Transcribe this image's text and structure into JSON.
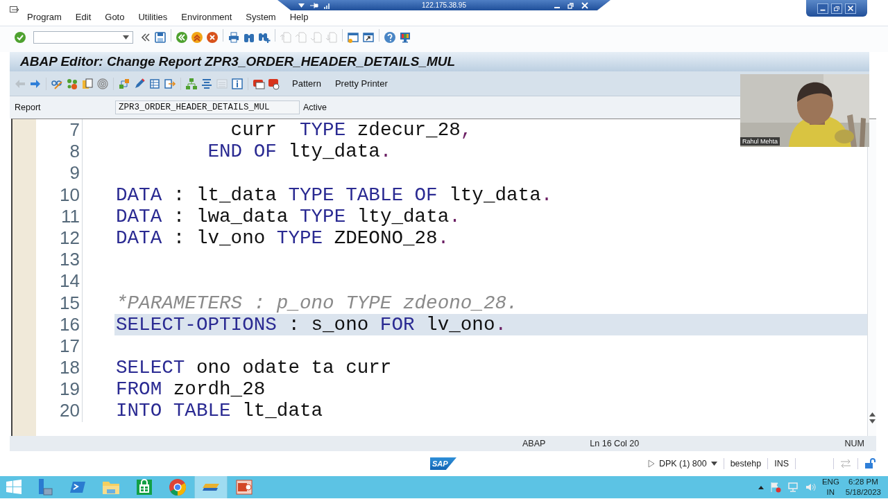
{
  "remote_bar": {
    "address": "122.175.38.95"
  },
  "menu": [
    "Program",
    "Edit",
    "Goto",
    "Utilities",
    "Environment",
    "System",
    "Help"
  ],
  "toolbar": {
    "groups": [
      [
        {
          "kind": "check",
          "disabled": false
        },
        {
          "kind": "command_field",
          "disabled": false
        },
        {
          "kind": "collapse",
          "disabled": false
        },
        {
          "kind": "save",
          "disabled": false
        }
      ],
      [
        {
          "kind": "back",
          "disabled": false
        },
        {
          "kind": "exit",
          "disabled": false
        },
        {
          "kind": "cancel",
          "disabled": false
        }
      ],
      [
        {
          "kind": "print",
          "disabled": false
        },
        {
          "kind": "find",
          "disabled": false
        },
        {
          "kind": "find_next",
          "disabled": false
        }
      ],
      [
        {
          "kind": "page_first",
          "disabled": true
        },
        {
          "kind": "page_prev",
          "disabled": true
        },
        {
          "kind": "page_next",
          "disabled": true
        },
        {
          "kind": "page_last",
          "disabled": true
        }
      ],
      [
        {
          "kind": "window_new",
          "disabled": false
        },
        {
          "kind": "shortcut",
          "disabled": false
        }
      ],
      [
        {
          "kind": "help",
          "disabled": false
        },
        {
          "kind": "monitor",
          "disabled": false
        }
      ]
    ]
  },
  "title": "ABAP Editor: Change Report ZPR3_ORDER_HEADER_DETAILS_MUL",
  "app_toolbar": {
    "groups": [
      [
        {
          "kind": "arrow_left",
          "disabled": true
        },
        {
          "kind": "arrow_right",
          "disabled": false
        }
      ],
      [
        {
          "kind": "glasses",
          "disabled": false
        },
        {
          "kind": "objects",
          "disabled": false
        },
        {
          "kind": "clipboard",
          "disabled": false
        },
        {
          "kind": "spiral",
          "disabled": false
        }
      ],
      [
        {
          "kind": "shapes",
          "disabled": false
        },
        {
          "kind": "pencil",
          "disabled": false
        },
        {
          "kind": "table_arrow",
          "disabled": false
        },
        {
          "kind": "box_arrow",
          "disabled": false
        }
      ],
      [
        {
          "kind": "hierarchy",
          "disabled": false
        },
        {
          "kind": "align",
          "disabled": false
        },
        {
          "kind": "list",
          "disabled": true
        },
        {
          "kind": "info",
          "disabled": false
        }
      ],
      [
        {
          "kind": "red_window",
          "disabled": false
        },
        {
          "kind": "red_stop",
          "disabled": false
        }
      ]
    ],
    "buttons": [
      "Pattern",
      "Pretty Printer"
    ]
  },
  "report": {
    "label": "Report",
    "value": "ZPR3_ORDER_HEADER_DETAILS_MUL",
    "status": "Active"
  },
  "editor": {
    "lines": [
      {
        "number": "7",
        "current": false,
        "tokens": [
          {
            "kind": "text",
            "text": "          curr  "
          },
          {
            "kind": "keyword",
            "text": "TYPE"
          },
          {
            "kind": "text",
            "text": " zdecur_28"
          },
          {
            "kind": "punct",
            "text": ","
          }
        ]
      },
      {
        "number": "8",
        "current": false,
        "tokens": [
          {
            "kind": "keyword",
            "text": "        END OF"
          },
          {
            "kind": "text",
            "text": " lty_data"
          },
          {
            "kind": "punct",
            "text": "."
          }
        ]
      },
      {
        "number": "9",
        "current": false
      },
      {
        "number": "10",
        "current": false,
        "tokens": [
          {
            "kind": "keyword",
            "text": "DATA"
          },
          {
            "kind": "text",
            "text": " : lt_data "
          },
          {
            "kind": "keyword",
            "text": "TYPE TABLE OF"
          },
          {
            "kind": "text",
            "text": " lty_data"
          },
          {
            "kind": "punct",
            "text": "."
          }
        ]
      },
      {
        "number": "11",
        "current": false,
        "tokens": [
          {
            "kind": "keyword",
            "text": "DATA"
          },
          {
            "kind": "text",
            "text": " : lwa_data "
          },
          {
            "kind": "keyword",
            "text": "TYPE"
          },
          {
            "kind": "text",
            "text": " lty_data"
          },
          {
            "kind": "punct",
            "text": "."
          }
        ]
      },
      {
        "number": "12",
        "current": false,
        "tokens": [
          {
            "kind": "keyword",
            "text": "DATA"
          },
          {
            "kind": "text",
            "text": " : lv_ono "
          },
          {
            "kind": "keyword",
            "text": "TYPE"
          },
          {
            "kind": "text",
            "text": " ZDEONO_28"
          },
          {
            "kind": "punct",
            "text": "."
          }
        ]
      },
      {
        "number": "13",
        "current": false
      },
      {
        "number": "14",
        "current": false
      },
      {
        "number": "15",
        "current": false,
        "tokens": [
          {
            "kind": "comment",
            "text": "*PARAMETERS : p_ono TYPE zdeono_28."
          }
        ]
      },
      {
        "number": "16",
        "current": true,
        "tokens": [
          {
            "kind": "keyword",
            "text": "SELECT-OPTIONS"
          },
          {
            "kind": "text",
            "text": " : s_ono "
          },
          {
            "kind": "keyword",
            "text": "FOR"
          },
          {
            "kind": "text",
            "text": " lv_ono"
          },
          {
            "kind": "punct",
            "text": "."
          }
        ]
      },
      {
        "number": "17",
        "current": false
      },
      {
        "number": "18",
        "current": false,
        "tokens": [
          {
            "kind": "keyword",
            "text": "SELECT"
          },
          {
            "kind": "text",
            "text": " ono odate ta curr"
          }
        ]
      },
      {
        "number": "19",
        "current": false,
        "tokens": [
          {
            "kind": "keyword",
            "text": "FROM"
          },
          {
            "kind": "text",
            "text": " zordh_28"
          }
        ]
      },
      {
        "number": "20",
        "current": false,
        "tokens": [
          {
            "kind": "keyword",
            "text": "INTO TABLE"
          },
          {
            "kind": "text",
            "text": " lt_data"
          }
        ]
      }
    ]
  },
  "video": {
    "kind": "picture",
    "name": "Rahul Mehta"
  },
  "status_bar": {
    "language": "ABAP",
    "position": "Ln 16 Col 20",
    "mode": "NUM"
  },
  "system_bar": {
    "logo": "SAP",
    "system": "DPK (1) 800",
    "server": "bestehp",
    "insert_mode": "INS"
  },
  "taskbar": {
    "apps": [
      {
        "kind": "start",
        "selected": false
      },
      {
        "kind": "server",
        "selected": false
      },
      {
        "kind": "terminal",
        "selected": false
      },
      {
        "kind": "folder",
        "selected": false
      },
      {
        "kind": "store",
        "selected": false
      },
      {
        "kind": "browser",
        "selected": false
      },
      {
        "kind": "sap",
        "selected": true
      },
      {
        "kind": "presentation",
        "selected": false
      }
    ],
    "language": "ENG",
    "region": "IN",
    "time": "6:28 PM",
    "date": "5/18/2023"
  }
}
